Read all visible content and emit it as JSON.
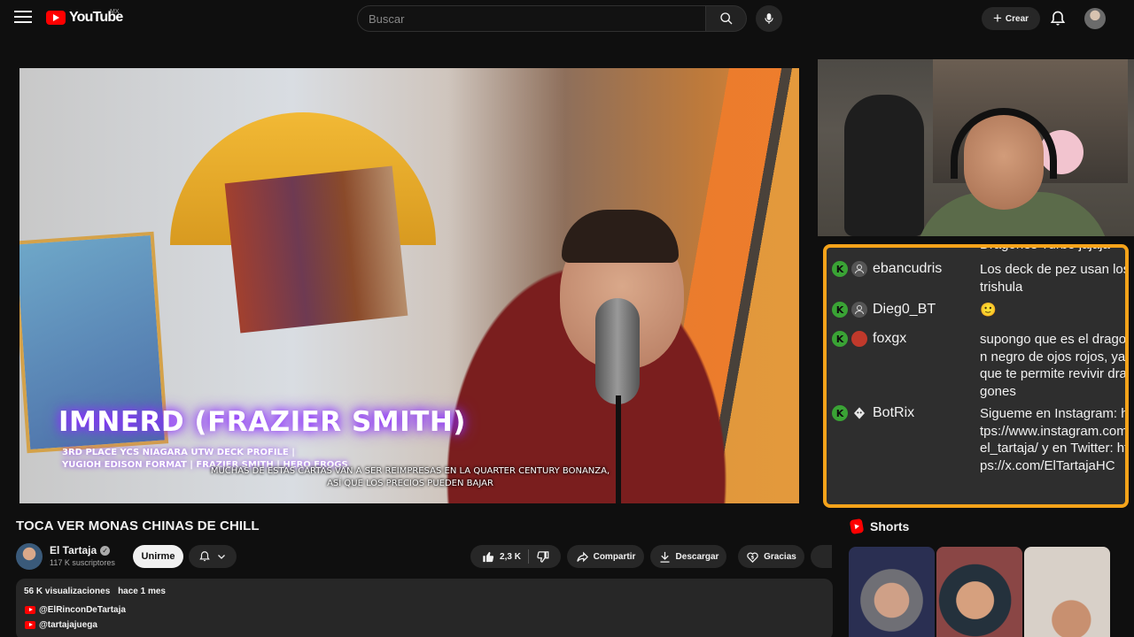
{
  "masthead": {
    "logo_text": "YouTube",
    "country": "MX",
    "search_placeholder": "Buscar",
    "create_label": "Crear"
  },
  "player": {
    "overlay_name": "IMNERD (FRAZIER SMITH)",
    "overlay_sub_1": "3RD PLACE YCS NIAGARA UTW DECK PROFILE |",
    "overlay_sub_2": "YUGIOH EDISON FORMAT | FRAZIER SMITH | HERO FROGS",
    "caption_1": "MUCHAS DE ESTAS CARTAS VAN A SER REIMPRESAS EN LA QUARTER CENTURY BONANZA,",
    "caption_2": "ASÍ QUE LOS PRECIOS PUEDEN BAJAR"
  },
  "chat": {
    "cut_text": "Dragones Turbo jajaja",
    "messages": [
      {
        "user": "ebancudris",
        "text": "Los deck de pez usan los trishula"
      },
      {
        "user": "Dieg0_BT",
        "text": "🙂"
      },
      {
        "user": "foxgx",
        "text": "supongo que es el dragon negro de ojos rojos, ya que te permite revivir dragones"
      },
      {
        "user": "BotRix",
        "text": "Sigueme en Instagram: https://www.instagram.com/el_tartaja/ y en Twitter: https://x.com/ElTartajaHC"
      }
    ],
    "badge_letter": "K",
    "accent_color": "#f5a31a"
  },
  "video": {
    "title": "TOCA VER MONAS CHINAS DE CHILL",
    "channel": "El Tartaja",
    "subscribers": "117 K suscriptores",
    "join_label": "Unirme",
    "likes": "2,3 K",
    "share_label": "Compartir",
    "download_label": "Descargar",
    "thanks_label": "Gracias"
  },
  "description": {
    "views": "56 K visualizaciones",
    "age": "hace 1 mes",
    "links": [
      "@ElRinconDeTartaja",
      "@tartajajuega"
    ]
  },
  "shorts": {
    "heading": "Shorts"
  }
}
